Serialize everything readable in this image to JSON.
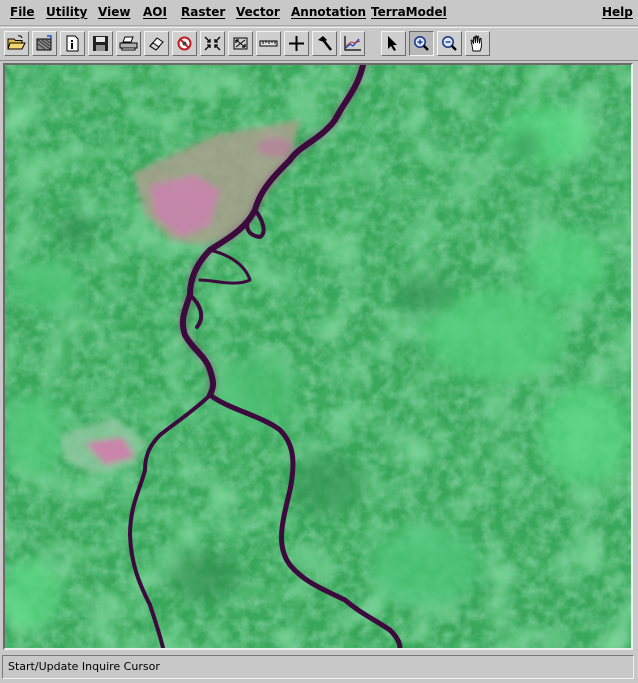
{
  "menubar": {
    "items": [
      {
        "label": "File"
      },
      {
        "label": "Utility"
      },
      {
        "label": "View"
      },
      {
        "label": "AOI"
      },
      {
        "label": "Raster"
      },
      {
        "label": "Vector"
      },
      {
        "label": "Annotation"
      },
      {
        "label": "TerraModel"
      }
    ],
    "help_label": "Help"
  },
  "toolbar": {
    "tools": [
      {
        "icon": "open-folder-icon"
      },
      {
        "icon": "open-layer-icon"
      },
      {
        "icon": "info-icon"
      },
      {
        "icon": "save-icon"
      },
      {
        "icon": "print-icon"
      },
      {
        "icon": "eraser-icon"
      },
      {
        "icon": "clear-view-icon"
      },
      {
        "icon": "zoom-fit-icon"
      },
      {
        "icon": "zoom-extent-icon"
      },
      {
        "icon": "measure-ruler-icon"
      },
      {
        "icon": "inquire-cursor-icon"
      },
      {
        "icon": "hammer-icon"
      },
      {
        "icon": "chart-icon"
      },
      {
        "icon": "arrow-pointer-icon"
      },
      {
        "icon": "zoom-in-icon",
        "active": true
      },
      {
        "icon": "zoom-out-icon"
      },
      {
        "icon": "pan-hand-icon"
      }
    ]
  },
  "viewer": {
    "image": "satellite-false-color-image"
  },
  "status": {
    "message": "Start/Update Inquire Cursor"
  },
  "colors": {
    "chrome": "#c8c8c8",
    "vegetation": "#3aa85c",
    "river": "#3d0a3e",
    "clearing": "#d07fb4"
  }
}
